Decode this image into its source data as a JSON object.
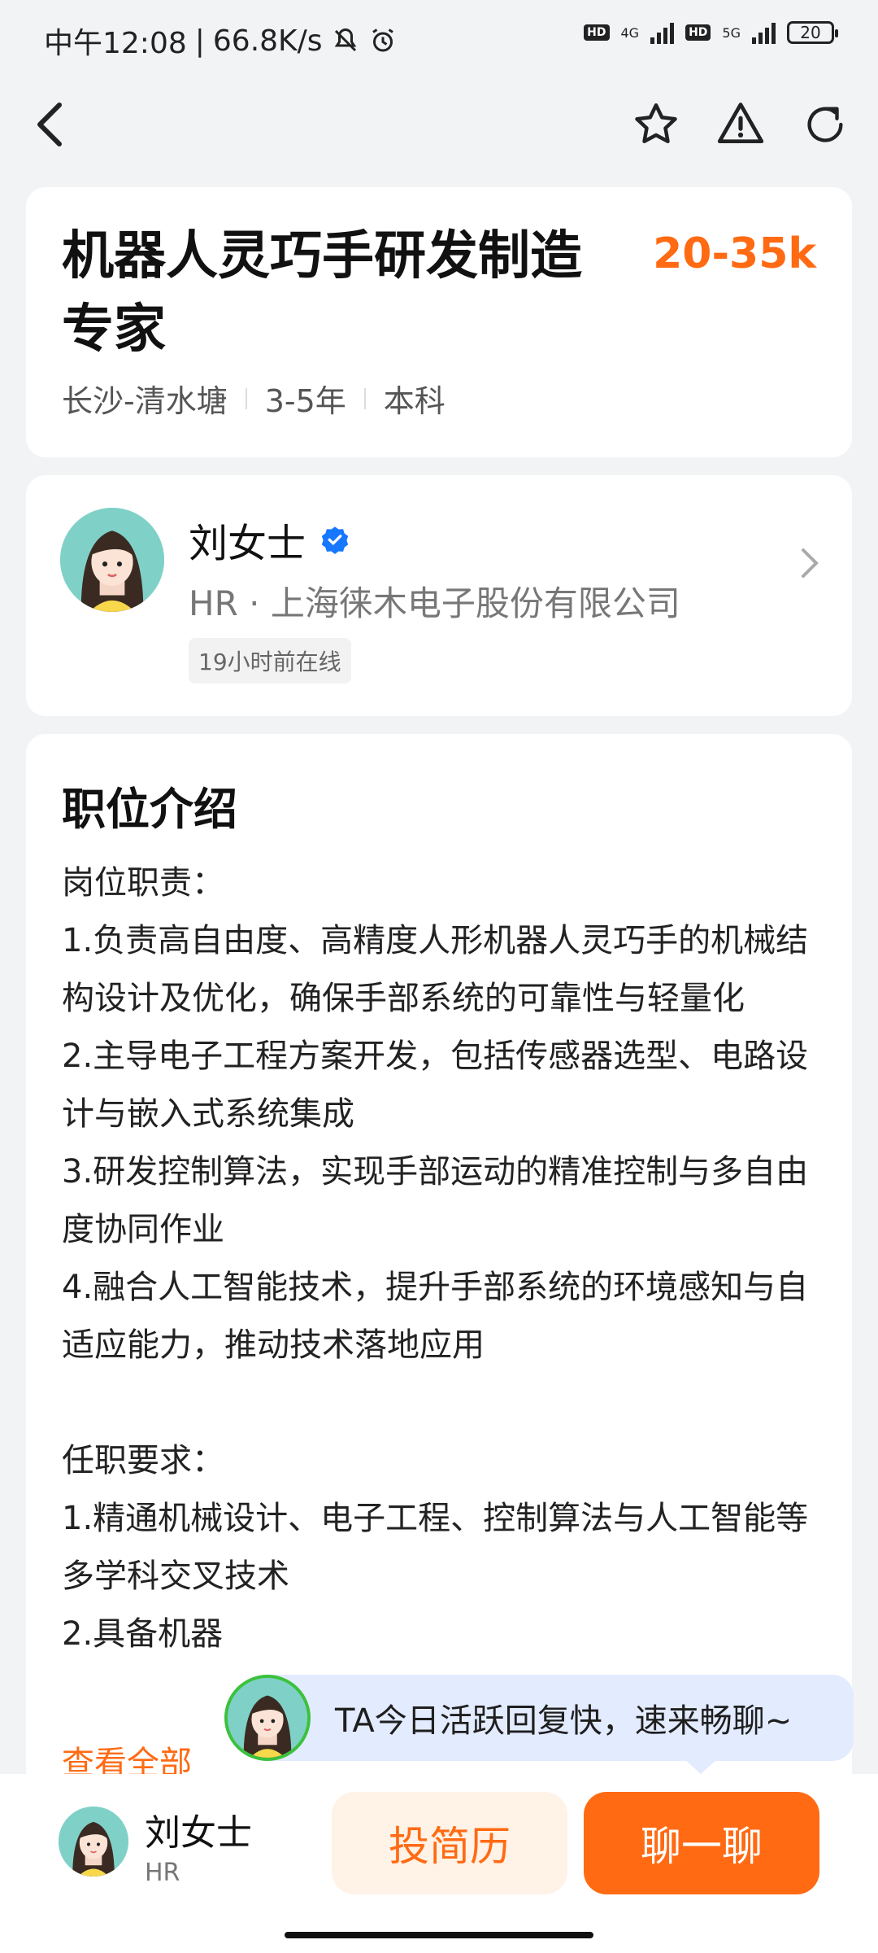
{
  "status_bar": {
    "time": "中午12:08",
    "speed": "66.8K/s",
    "network_1": "4G",
    "network_2": "5G",
    "battery": "20"
  },
  "job": {
    "title": "机器人灵巧手研发制造专家",
    "salary": "20-35k",
    "location": "长沙-清水塘",
    "experience": "3-5年",
    "education": "本科"
  },
  "recruiter": {
    "name": "刘女士",
    "role_company": "HR · 上海徕木电子股份有限公司",
    "online_status": "19小时前在线"
  },
  "description": {
    "section_title": "职位介绍",
    "duties_heading": "岗位职责：",
    "duties": [
      "1.负责高自由度、高精度人形机器人灵巧手的机械结构设计及优化，确保手部系统的可靠性与轻量化",
      "2.主导电子工程方案开发，包括传感器选型、电路设计与嵌入式系统集成",
      "3.研发控制算法，实现手部运动的精准控制与多自由度协同作业",
      "4.融合人工智能技术，提升手部系统的环境感知与自适应能力，推动技术落地应用"
    ],
    "requirements_heading": "任职要求：",
    "requirements": [
      "1.精通机械设计、电子工程、控制算法与人工智能等多学科交叉技术",
      "2.具备机器"
    ],
    "see_all": "查看全部"
  },
  "chat_tip": "TA今日活跃回复快，速来畅聊~",
  "bottom_bar": {
    "name": "刘女士",
    "role": "HR",
    "resume_button": "投简历",
    "chat_button": "聊一聊"
  },
  "colors": {
    "accent": "#ff6a13",
    "verified": "#1677ff",
    "online_ring": "#3cc13c"
  }
}
